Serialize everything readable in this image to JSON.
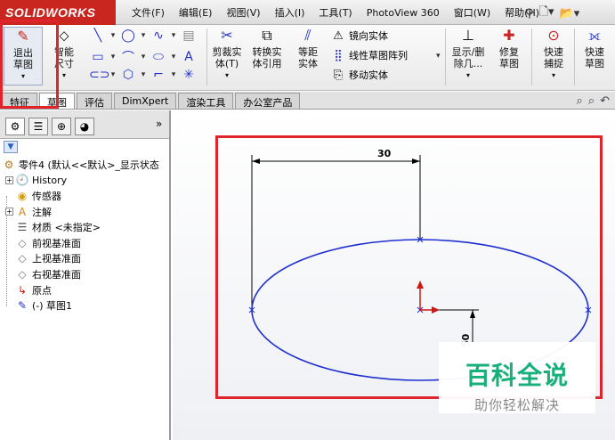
{
  "app": {
    "logo_text": "SOLIDWORKS",
    "accent_color": "#c9261f",
    "highlight_color": "#e0242c"
  },
  "menu": {
    "items": [
      "文件(F)",
      "编辑(E)",
      "视图(V)",
      "插入(I)",
      "工具(T)",
      "PhotoView 360",
      "窗口(W)",
      "帮助(H)"
    ]
  },
  "title_tools": [
    "pin-icon",
    "new-document-icon",
    "open-folder-icon"
  ],
  "ribbon": {
    "exit_sketch": "退出草图",
    "smart_dimension": "智能尺寸",
    "trim": "剪裁实体(T)",
    "convert": "转换实体引用",
    "offset": "等距实体",
    "mirror": "镜向实体",
    "linear_pattern": "线性草图阵列",
    "move": "移动实体",
    "display_delete": "显示/删除几...",
    "repair": "修复草图",
    "quick_snap": "快速捕捉",
    "quick_sketch": "快速草图",
    "sketch_tool_icons": [
      "line-icon",
      "circle-icon",
      "spline-icon",
      "rectangle-icon",
      "arc-icon",
      "ellipse-icon",
      "text-icon",
      "slot-icon",
      "polygon-icon",
      "fillet-icon",
      "point-icon",
      "plane-icon"
    ]
  },
  "tabs": [
    "特征",
    "草图",
    "评估",
    "DimXpert",
    "渲染工具",
    "办公室产品"
  ],
  "active_tab": 1,
  "tree": {
    "more": "»",
    "items": [
      {
        "label": "零件4 (默认<<默认>_显示状态",
        "icon": "part-icon",
        "expand": "none"
      },
      {
        "label": "History",
        "icon": "history-icon",
        "expand": "+"
      },
      {
        "label": "传感器",
        "icon": "sensor-icon",
        "expand": "none"
      },
      {
        "label": "注解",
        "icon": "annotation-icon",
        "expand": "+"
      },
      {
        "label": "材质 <未指定>",
        "icon": "material-icon",
        "expand": "none"
      },
      {
        "label": "前视基准面",
        "icon": "plane-icon",
        "expand": "none"
      },
      {
        "label": "上视基准面",
        "icon": "plane-icon",
        "expand": "none"
      },
      {
        "label": "右视基准面",
        "icon": "plane-icon",
        "expand": "none"
      },
      {
        "label": "原点",
        "icon": "origin-icon",
        "expand": "none"
      },
      {
        "label": "(-) 草图1",
        "icon": "sketch-icon",
        "expand": "none"
      }
    ]
  },
  "sketch": {
    "dim_horizontal": "30",
    "dim_vertical": "50",
    "ellipse_color": "#1f2fd0",
    "origin_color": "#d01616"
  },
  "watermark": {
    "title": "百科全说",
    "subtitle": "助你轻松解决"
  }
}
